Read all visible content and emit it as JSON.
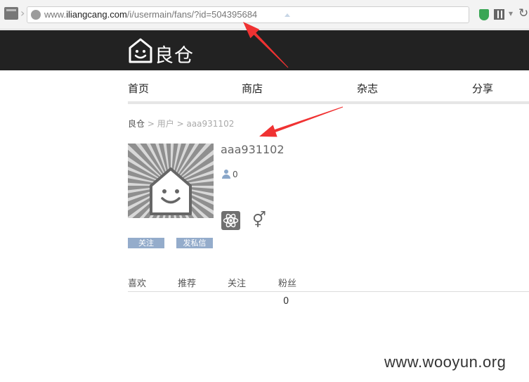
{
  "browser": {
    "url_prefix": "www.",
    "url_host": "iliangcang.com",
    "url_path": "/i/usermain/fans/?id=504395684"
  },
  "site": {
    "logo_text": "良仓"
  },
  "nav": {
    "items": [
      "首页",
      "商店",
      "杂志",
      "分享"
    ]
  },
  "breadcrumb": {
    "home": "良仓",
    "sep": ">",
    "section": "用户",
    "current": "aaa931102"
  },
  "profile": {
    "username": "aaa931102",
    "fans_count": "0",
    "gender_symbol": "⚥",
    "follow_label": "关注",
    "message_label": "发私信"
  },
  "tabs": {
    "items": [
      "喜欢",
      "推荐",
      "关注",
      "粉丝"
    ],
    "active_index": 3,
    "active_count": "0"
  },
  "annotations": {
    "arrow_color": "#f03232"
  },
  "watermark": {
    "text": "www.wooyun.org"
  }
}
